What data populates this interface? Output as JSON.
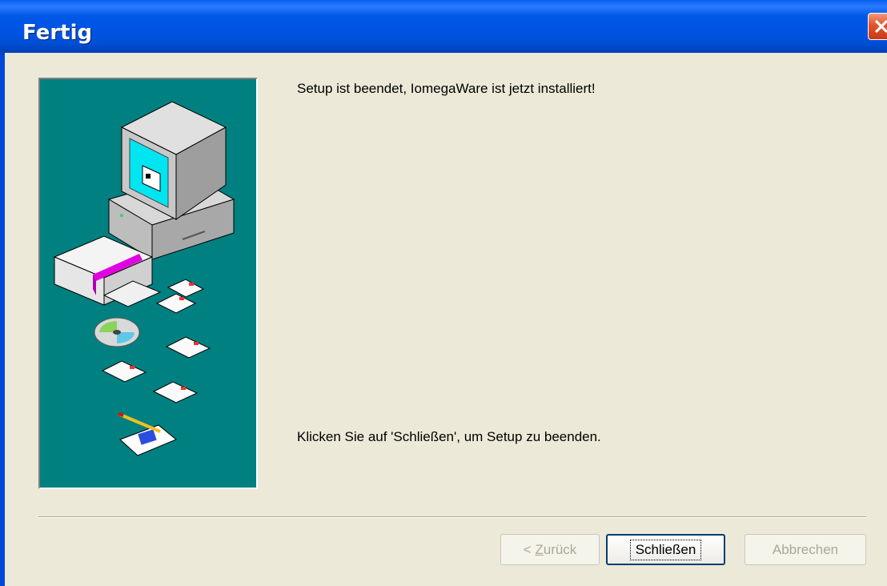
{
  "window": {
    "title": "Fertig",
    "close_icon": "close-icon"
  },
  "content": {
    "message_top": "Setup ist beendet, IomegaWare ist jetzt installiert!",
    "message_bottom": "Klicken Sie auf 'Schließen', um Setup zu beenden.",
    "illustration": "setup-computer-disks-illustration"
  },
  "buttons": {
    "back_prefix": "< ",
    "back_accel": "Z",
    "back_rest": "urück",
    "close_label": "Schließen",
    "cancel_label": "Abbrechen"
  },
  "colors": {
    "titlebar": "#0054e3",
    "panel": "#008080",
    "dialog": "#ece9d8"
  }
}
